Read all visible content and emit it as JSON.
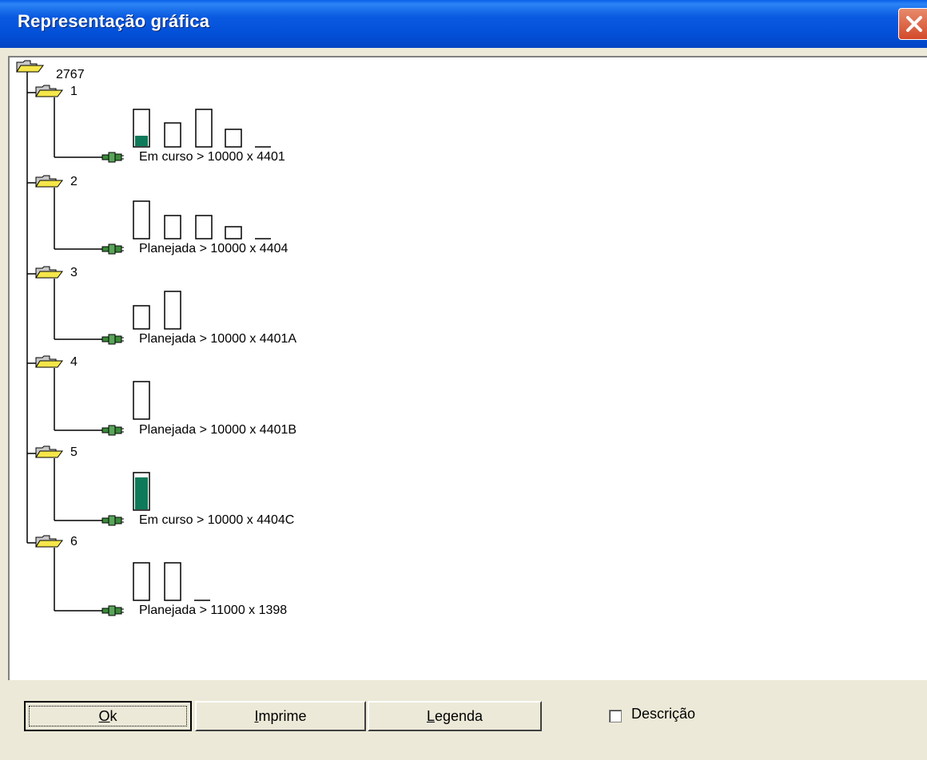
{
  "window": {
    "title": "Representação gráfica"
  },
  "tree": {
    "root": "2767",
    "nodes": [
      {
        "label": "1",
        "item": "Em curso > 10000 x 4401"
      },
      {
        "label": "2",
        "item": "Planejada > 10000 x 4404"
      },
      {
        "label": "3",
        "item": "Planejada > 10000 x 4401A"
      },
      {
        "label": "4",
        "item": "Planejada > 10000 x 4401B"
      },
      {
        "label": "5",
        "item": "Em curso > 10000 x 4404C"
      },
      {
        "label": "6",
        "item": "Planejada > 11000 x 1398"
      }
    ]
  },
  "buttons": {
    "ok": {
      "mnemonic": "O",
      "rest": "k"
    },
    "print": {
      "mnemonic": "I",
      "rest": "mprime"
    },
    "legend": {
      "mnemonic": "L",
      "rest": "egenda"
    }
  },
  "checkbox": {
    "label": "Descrição",
    "checked": false
  },
  "colors": {
    "progress_fill": "#0f7a5a",
    "title_bar": "#0350d8"
  }
}
